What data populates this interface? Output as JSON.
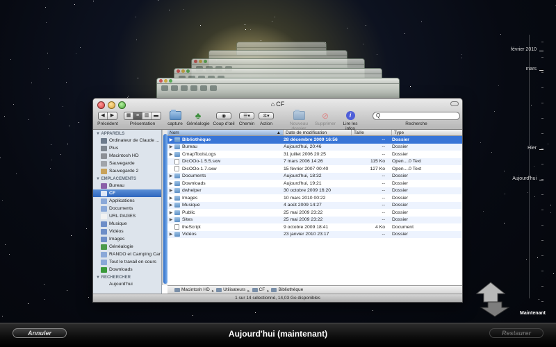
{
  "window": {
    "title": "CF"
  },
  "toolbar": {
    "back_label": "Précédent",
    "view_label": "Présentation",
    "capture_label": "capture",
    "genealogie_label": "Généalogie",
    "quicklook_label": "Coup d'œil",
    "path_label": "Chemin",
    "action_label": "Action",
    "new_folder_label": "Nouveau dossier",
    "delete_label": "Supprimer",
    "info_label": "Lire les infos",
    "search_label": "Recherche",
    "search_placeholder": "Q"
  },
  "sidebar": {
    "sections": [
      {
        "title": "▼ APPAREILS",
        "items": [
          {
            "label": "Ordinateur de Claude ...",
            "icon": "computer-icon",
            "color": "#6d7b8c"
          },
          {
            "label": "Plus",
            "icon": "disk-icon",
            "color": "#7f8790"
          },
          {
            "label": "Macintosh HD",
            "icon": "disk-icon",
            "color": "#8c9096"
          },
          {
            "label": "Sauvegarde",
            "icon": "disk-icon",
            "color": "#a0a4aa"
          },
          {
            "label": "Sauvegarde 2",
            "icon": "disk-icon",
            "color": "#c8a25a"
          }
        ]
      },
      {
        "title": "▼ EMPLACEMENTS",
        "items": [
          {
            "label": "Bureau",
            "icon": "desktop-icon",
            "color": "#8a5fa8"
          },
          {
            "label": "CF",
            "icon": "home-icon",
            "color": "#e0e8f6",
            "selected": true
          },
          {
            "label": "Applications",
            "icon": "applications-icon",
            "color": "#8aa8d8"
          },
          {
            "label": "Documents",
            "icon": "documents-icon",
            "color": "#8aa8d8"
          },
          {
            "label": "URL PAGES",
            "icon": "document-icon",
            "color": "#f2f2f2"
          },
          {
            "label": "Musique",
            "icon": "music-icon",
            "color": "#6d8ec8"
          },
          {
            "label": "Vidéos",
            "icon": "movies-icon",
            "color": "#6d8ec8"
          },
          {
            "label": "Images",
            "icon": "pictures-icon",
            "color": "#6d8ec8"
          },
          {
            "label": "Généalogie",
            "icon": "tree-icon",
            "color": "#4c9a4c"
          },
          {
            "label": "RANDO et Camping Car",
            "icon": "folder-icon",
            "color": "#8aa8d8"
          },
          {
            "label": "Tout le travail en cours",
            "icon": "folder-icon",
            "color": "#8aa8d8"
          },
          {
            "label": "Downloads",
            "icon": "downloads-icon",
            "color": "#3a9a3a"
          }
        ]
      },
      {
        "title": "▼ RECHERCHER",
        "items": [
          {
            "label": "Aujourd'hui",
            "icon": "clock-icon",
            "color": "#dde4ec"
          }
        ]
      }
    ]
  },
  "list": {
    "headers": {
      "name": "Nom",
      "date": "Date de modification",
      "size": "Taille",
      "type": "Type"
    },
    "rows": [
      {
        "name": "Bibliothèque",
        "date": "28 décembre 2009 16:56",
        "size": "--",
        "type": "Dossier",
        "folder": true,
        "selected": true
      },
      {
        "name": "Bureau",
        "date": "Aujourd'hui, 20:46",
        "size": "--",
        "type": "Dossier",
        "folder": true
      },
      {
        "name": "CmapToolsLogs",
        "date": "31 juillet 2006 20:25",
        "size": "--",
        "type": "Dossier",
        "folder": true
      },
      {
        "name": "DicOOo-1.5.5.sxw",
        "date": "7 mars 2006 14:26",
        "size": "115 Ko",
        "type": "Open....0 Text",
        "folder": false
      },
      {
        "name": "DicOOo-1.7.sxw",
        "date": "15 février 2007 00:40",
        "size": "127 Ko",
        "type": "Open....0 Text",
        "folder": false
      },
      {
        "name": "Documents",
        "date": "Aujourd'hui, 18:32",
        "size": "--",
        "type": "Dossier",
        "folder": true
      },
      {
        "name": "Downloads",
        "date": "Aujourd'hui, 19:21",
        "size": "--",
        "type": "Dossier",
        "folder": true
      },
      {
        "name": "dwhelper",
        "date": "30 octobre 2009 16:20",
        "size": "--",
        "type": "Dossier",
        "folder": true
      },
      {
        "name": "Images",
        "date": "10 mars 2010 00:22",
        "size": "--",
        "type": "Dossier",
        "folder": true
      },
      {
        "name": "Musique",
        "date": "4 août 2009 14:27",
        "size": "--",
        "type": "Dossier",
        "folder": true
      },
      {
        "name": "Public",
        "date": "25 mai 2009 23:22",
        "size": "--",
        "type": "Dossier",
        "folder": true
      },
      {
        "name": "Sites",
        "date": "25 mai 2009 23:22",
        "size": "--",
        "type": "Dossier",
        "folder": true
      },
      {
        "name": "theScript",
        "date": "9 octobre 2009 18:41",
        "size": "4 Ko",
        "type": "Document",
        "folder": false
      },
      {
        "name": "Vidéos",
        "date": "23 janvier 2010 23:17",
        "size": "--",
        "type": "Dossier",
        "folder": true
      }
    ]
  },
  "pathbar": {
    "segments": [
      "Macintosh HD",
      "Utilisateurs",
      "CF",
      "Bibliothèque"
    ]
  },
  "status": {
    "text": "1 sur 14 sélectionné, 14,03 Go disponibles"
  },
  "timeline": {
    "labels": [
      {
        "text": "février 2010"
      },
      {
        "text": "mars"
      },
      {
        "text": "Hier"
      },
      {
        "text": "Aujourd'hui"
      }
    ],
    "now_label": "Maintenant"
  },
  "bottom": {
    "cancel_label": "Annuler",
    "title": "Aujourd'hui (maintenant)",
    "restore_label": "Restaurer"
  }
}
